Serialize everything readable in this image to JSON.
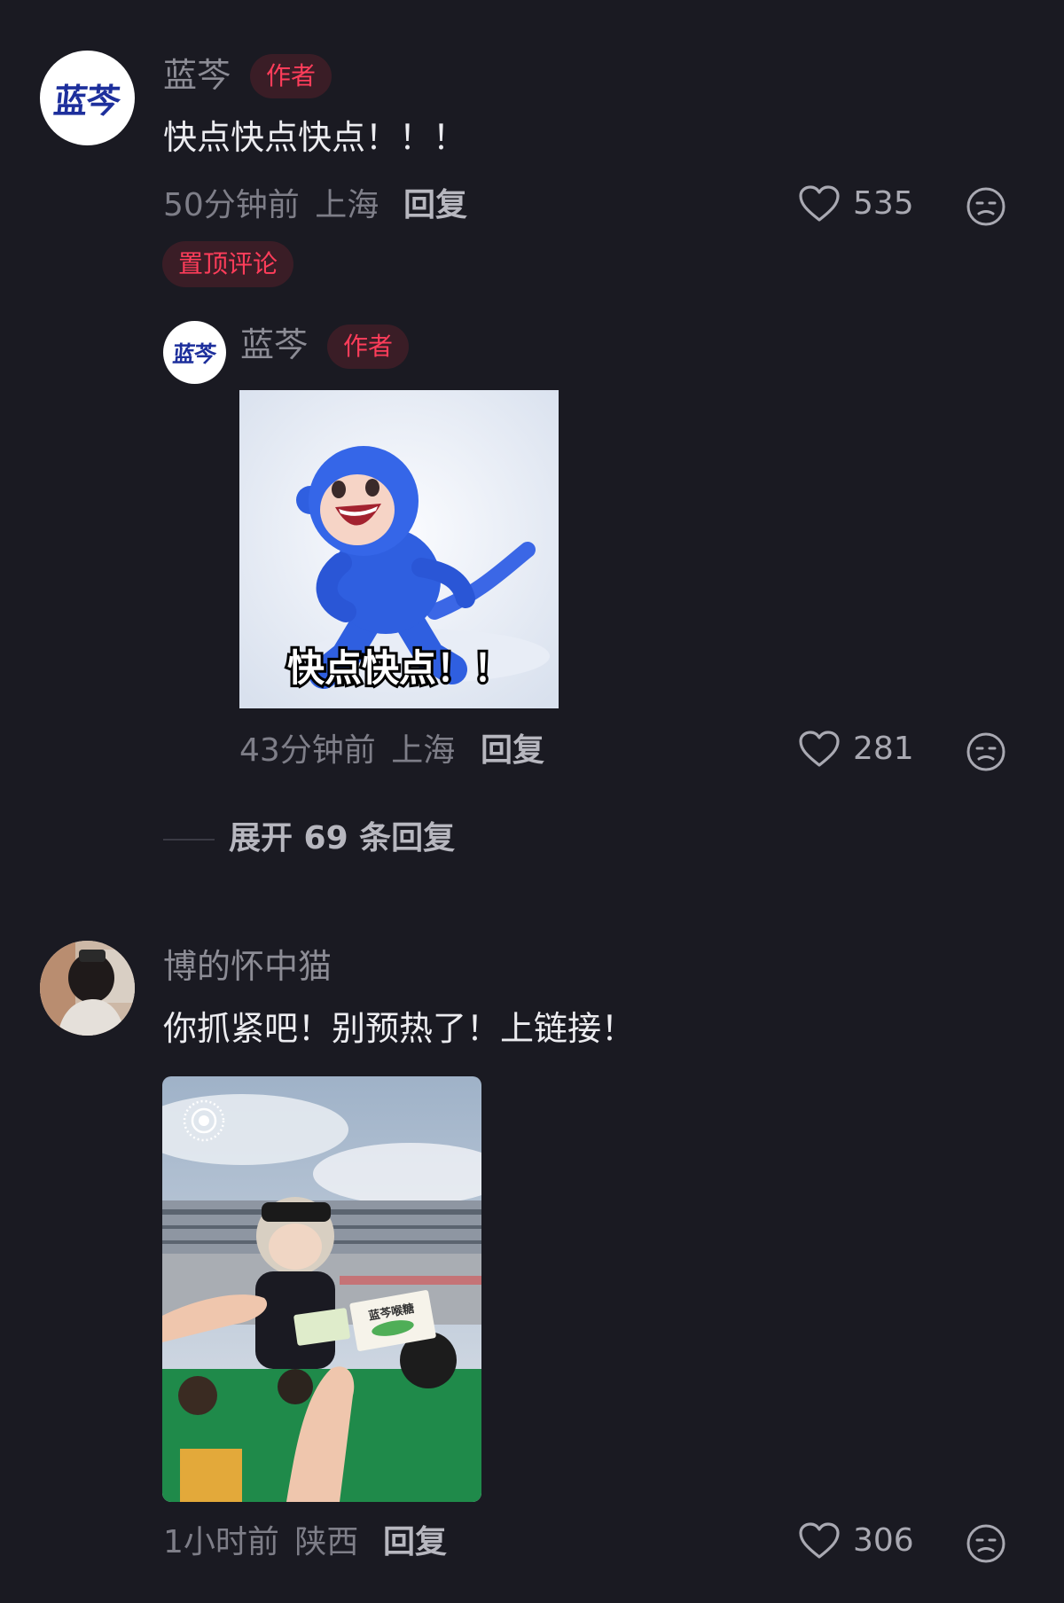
{
  "comments": [
    {
      "avatar_text": "蓝芩",
      "username": "蓝芩",
      "badge": "作者",
      "text": "快点快点快点！！！",
      "time": "50分钟前",
      "location": "上海",
      "reply_label": "回复",
      "likes": "535",
      "pinned_label": "置顶评论",
      "replies": [
        {
          "avatar_text": "蓝芩",
          "username": "蓝芩",
          "badge": "作者",
          "sticker_caption": "快点快点！！",
          "time": "43分钟前",
          "location": "上海",
          "reply_label": "回复",
          "likes": "281"
        }
      ],
      "expand_label": "展开 69 条回复"
    },
    {
      "username": "博的怀中猫",
      "text": "你抓紧吧！别预热了！上链接！",
      "time": "1小时前",
      "location": "陕西",
      "reply_label": "回复",
      "likes": "306",
      "photo_pack_text": "蓝芩喉糖"
    }
  ],
  "colors": {
    "background": "#1a1a22",
    "badge_text": "#ff3d5a",
    "badge_bg": "#3a1d26",
    "monkey_blue": "#2f5fe0"
  },
  "icons": [
    "heart-icon",
    "dislike-face-icon",
    "live-photo-icon"
  ]
}
